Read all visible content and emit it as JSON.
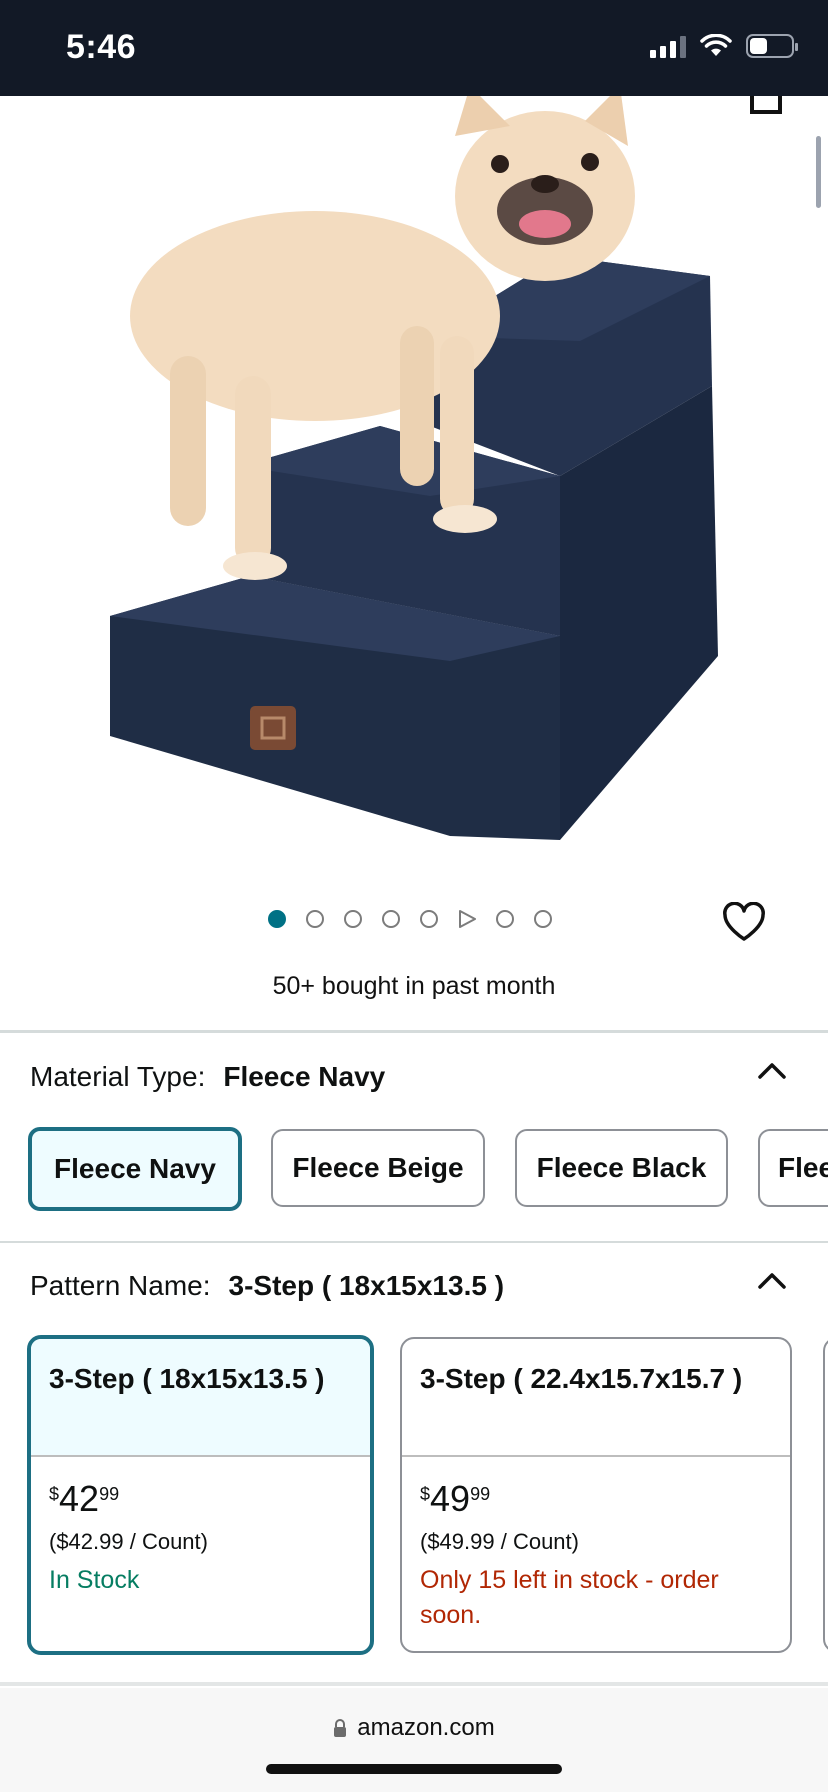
{
  "status_bar": {
    "time": "5:46"
  },
  "gallery": {
    "dot_count": 8,
    "active_index": 0,
    "video_index": 5
  },
  "social_proof": {
    "text": "50+ bought in past month"
  },
  "material": {
    "label": "Material Type:",
    "selected": "Fleece Navy",
    "options": [
      "Fleece Navy",
      "Fleece Beige",
      "Fleece Black",
      "Flee"
    ]
  },
  "pattern": {
    "label": "Pattern Name:",
    "selected": "3-Step ( 18x15x13.5 )",
    "options": [
      {
        "name": "3-Step ( 18x15x13.5 )",
        "price_symbol": "$",
        "price_whole": "42",
        "price_fraction": "99",
        "unit_price": "($42.99 / Count)",
        "availability": "In Stock"
      },
      {
        "name": "3-Step ( 22.4x15.7x15.7 )",
        "price_symbol": "$",
        "price_whole": "49",
        "price_fraction": "99",
        "unit_price": "($49.99 / Count)",
        "availability": "Only 15 left in stock - order soon."
      }
    ]
  },
  "browser": {
    "url": "amazon.com"
  },
  "colors": {
    "accent": "#007185",
    "selected_border": "#1d6f83",
    "in_stock": "#067d62",
    "low_stock": "#b12704",
    "status_bar": "#121926"
  }
}
